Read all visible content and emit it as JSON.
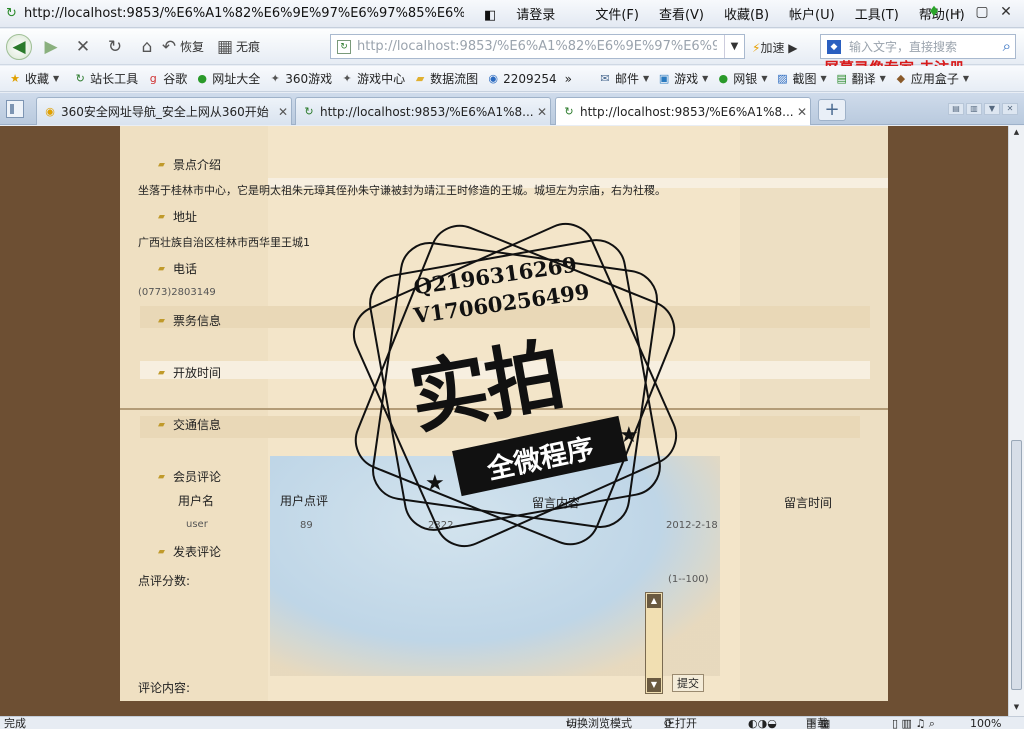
{
  "window": {
    "title_url": "http://localhost:9853/%E6%A1%82%E6%9E%97%E6%97%85%E6%B8...",
    "login": "请登录",
    "menu": [
      "文件(F)",
      "查看(V)",
      "收藏(B)",
      "帐户(U)",
      "工具(T)",
      "帮助(H)"
    ]
  },
  "navbar": {
    "restore_label": "恢复",
    "no_trace_label": "无痕",
    "address": "http://localhost:9853/%E6%A1%82%E6%9E%97%E6%97%85%E6%",
    "speed_label": "加速",
    "search_placeholder": "输入文字，直接搜索",
    "watermark": "屏幕录像专家 未注册"
  },
  "favorites": [
    "收藏",
    "站长工具",
    "谷歌",
    "网址大全",
    "360游戏",
    "游戏中心",
    "数据流图",
    "2209254",
    "邮件",
    "游戏",
    "网银",
    "截图",
    "翻译",
    "应用盒子"
  ],
  "tabs": [
    {
      "label": "360安全网址导航_安全上网从360开始"
    },
    {
      "label": "http://localhost:9853/%E6%A1%8..."
    },
    {
      "label": "http://localhost:9853/%E6%A1%8..."
    }
  ],
  "content": {
    "sections": {
      "intro_title": "景点介绍",
      "intro_text": "坐落于桂林市中心，它是明太祖朱元璋其侄孙朱守谦被封为靖江王时修造的王城。城垣左为宗庙，右为社稷。",
      "address_title": "地址",
      "address_text": "广西壮族自治区桂林市西华里王城1",
      "phone_title": "电话",
      "phone_text": "(0773)2803149",
      "ticket_title": "票务信息",
      "hours_title": "开放时间",
      "traffic_title": "交通信息",
      "review_title": "会员评论",
      "post_title": "发表评论",
      "score_label": "点评分数:",
      "score_range": "(1--100)",
      "comment_label": "评论内容:",
      "submit_label": "提交"
    },
    "review_table": {
      "headers": [
        "用户名",
        "用户点评",
        "留言内容",
        "留言时间"
      ],
      "rows": [
        {
          "user": "user",
          "score": "89",
          "content": "2322",
          "time": "2012-2-18"
        }
      ]
    }
  },
  "stamp": {
    "qq": "Q2196316269",
    "wechat": "V17060256499",
    "big": "实拍",
    "ribbon": "全微程序"
  },
  "status": {
    "left": "完成",
    "mode": "切换浏览模式",
    "open": "正打开",
    "download": "下载",
    "zoom": "100%"
  }
}
